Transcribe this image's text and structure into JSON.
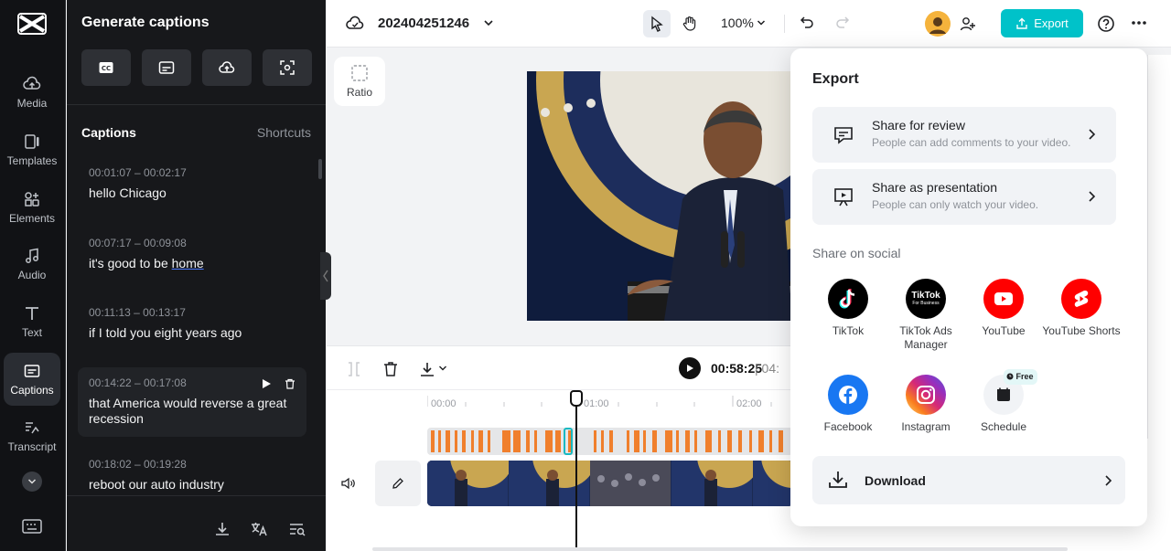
{
  "rail": {
    "items": [
      {
        "label": "Media",
        "icon": "cloud-upload-icon"
      },
      {
        "label": "Templates",
        "icon": "templates-icon"
      },
      {
        "label": "Elements",
        "icon": "elements-icon"
      },
      {
        "label": "Audio",
        "icon": "music-note-icon"
      },
      {
        "label": "Text",
        "icon": "text-icon"
      },
      {
        "label": "Captions",
        "icon": "captions-icon"
      },
      {
        "label": "Transcript",
        "icon": "transcript-icon"
      }
    ]
  },
  "panel": {
    "title": "Generate captions",
    "captions_heading": "Captions",
    "shortcuts_label": "Shortcuts",
    "captions": [
      {
        "time": "00:01:07 – 00:02:17",
        "text": "hello Chicago"
      },
      {
        "time": "00:07:17 – 00:09:08",
        "text_before": "it's good to be ",
        "text_underlined": "home"
      },
      {
        "time": "00:11:13 – 00:13:17",
        "text": "if I told you eight years ago"
      },
      {
        "time": "00:14:22 – 00:17:08",
        "text": "that America would reverse a great recession"
      },
      {
        "time": "00:18:02 – 00:19:28",
        "text": "reboot our auto industry"
      }
    ]
  },
  "topbar": {
    "project_name": "202404251246",
    "zoom": "100%",
    "export_label": "Export"
  },
  "canvas": {
    "ratio_label": "Ratio"
  },
  "timeline": {
    "current_time": "00:58:25",
    "total_time_partial": "04:",
    "ticks": [
      "00:00",
      "01:00",
      "02:00"
    ]
  },
  "export_popup": {
    "title": "Export",
    "share_review": {
      "title": "Share for review",
      "subtitle": "People can add comments to your video."
    },
    "share_presentation": {
      "title": "Share as presentation",
      "subtitle": "People can only watch your video."
    },
    "social_heading": "Share on social",
    "social": [
      {
        "label": "TikTok",
        "color": "#000000"
      },
      {
        "label": "TikTok Ads Manager",
        "color": "#000000",
        "logo_text": "TikTok",
        "logo_sub": "For Business"
      },
      {
        "label": "YouTube",
        "color": "#ff0000"
      },
      {
        "label": "YouTube Shorts",
        "color": "#ff0000"
      },
      {
        "label": "Facebook",
        "color": "#1877f2"
      },
      {
        "label": "Instagram",
        "color": "#e1306c"
      },
      {
        "label": "Schedule",
        "color": "#f1f3f6",
        "badge": "Free"
      }
    ],
    "download_label": "Download"
  },
  "colors": {
    "accent": "#00c2c9",
    "caption_marker": "#f07f2c"
  }
}
